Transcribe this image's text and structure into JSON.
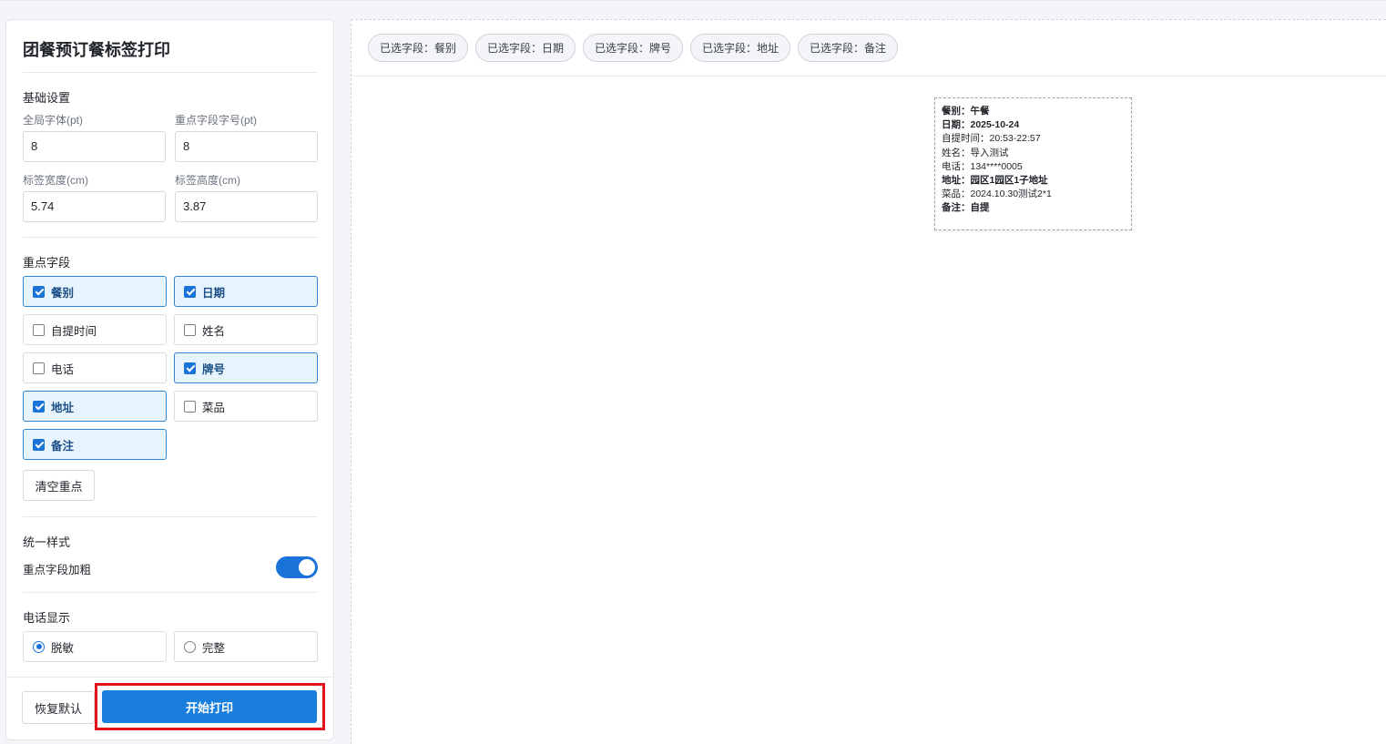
{
  "panel": {
    "title": "团餐预订餐标签打印",
    "basic": {
      "section": "基础设置",
      "font_label": "全局字体(pt)",
      "font_value": "8",
      "key_font_label": "重点字段字号(pt)",
      "key_font_value": "8",
      "width_label": "标签宽度(cm)",
      "width_value": "5.74",
      "height_label": "标签高度(cm)",
      "height_value": "3.87"
    },
    "key_fields": {
      "section": "重点字段",
      "items": [
        {
          "label": "餐别",
          "checked": true
        },
        {
          "label": "日期",
          "checked": true
        },
        {
          "label": "自提时间",
          "checked": false
        },
        {
          "label": "姓名",
          "checked": false
        },
        {
          "label": "电话",
          "checked": false
        },
        {
          "label": "牌号",
          "checked": true
        },
        {
          "label": "地址",
          "checked": true
        },
        {
          "label": "菜品",
          "checked": false
        },
        {
          "label": "备注",
          "checked": true
        }
      ],
      "clear_label": "清空重点"
    },
    "style": {
      "section": "统一样式",
      "bold_label": "重点字段加粗",
      "bold_on": true
    },
    "phone": {
      "section": "电话显示",
      "options": [
        {
          "label": "脱敏",
          "selected": true
        },
        {
          "label": "完整",
          "selected": false
        }
      ]
    },
    "footer": {
      "reset_label": "恢复默认",
      "print_label": "开始打印"
    }
  },
  "chips": [
    "已选字段：餐别",
    "已选字段：日期",
    "已选字段：牌号",
    "已选字段：地址",
    "已选字段：备注"
  ],
  "label_preview": [
    {
      "text": "餐别：午餐",
      "bold": true
    },
    {
      "text": "日期：2025-10-24",
      "bold": true
    },
    {
      "text": "自提时间：20:53-22:57",
      "bold": false
    },
    {
      "text": "姓名：导入测试",
      "bold": false
    },
    {
      "text": "电话：134****0005",
      "bold": false
    },
    {
      "text": "地址：园区1园区1子地址",
      "bold": true
    },
    {
      "text": "菜品：2024.10.30测试2*1",
      "bold": false
    },
    {
      "text": "备注：自提",
      "bold": true
    }
  ],
  "colors": {
    "accent": "#1a7fdc",
    "highlight": "#e3151b"
  }
}
